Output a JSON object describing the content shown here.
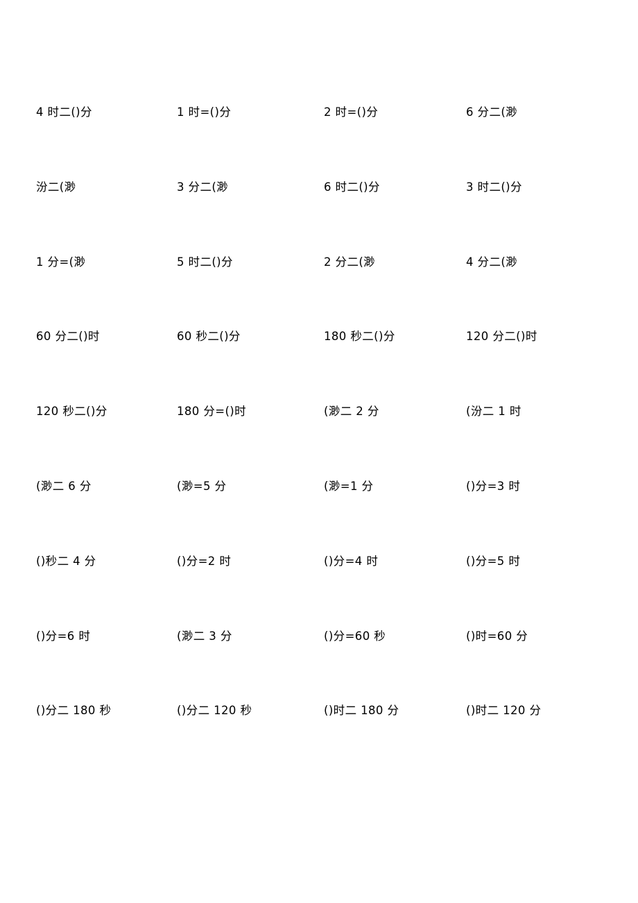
{
  "document": {
    "kind": "math-worksheet",
    "background_color": "#ffffff",
    "text_color": "#000000",
    "columns": 4,
    "rows": 9
  },
  "problems": [
    [
      "4 时二()分",
      "1 时=()分",
      "2 时=()分",
      "6 分二(渺"
    ],
    [
      "汾二(渺",
      "3 分二(渺",
      "6 时二()分",
      "3 时二()分"
    ],
    [
      "1 分=(渺",
      "5 时二()分",
      "2 分二(渺",
      "4 分二(渺"
    ],
    [
      "60 分二()时",
      "60 秒二()分",
      "180 秒二()分",
      "120 分二()时"
    ],
    [
      "120 秒二()分",
      "180 分=()时",
      "(渺二 2 分",
      "(汾二 1 时"
    ],
    [
      "(渺二 6 分",
      "(渺=5 分",
      "(渺=1 分",
      "()分=3 时"
    ],
    [
      "()秒二 4 分",
      "()分=2 时",
      "()分=4 时",
      "()分=5 时"
    ],
    [
      "()分=6 时",
      "(渺二 3 分",
      "()分=60 秒",
      "()时=60 分"
    ],
    [
      "()分二 180 秒",
      "()分二 120 秒",
      "()时二 180 分",
      "()时二 120 分"
    ]
  ]
}
